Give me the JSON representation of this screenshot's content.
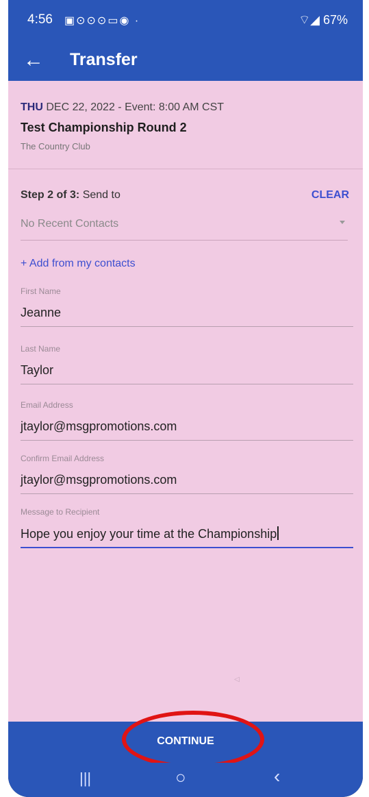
{
  "status_bar": {
    "time": "4:56",
    "notification_icons": "▣⊙⊙⊙▭◉ ·",
    "battery": "67%",
    "signal_glyph": "⌔◢"
  },
  "app_bar": {
    "title": "Transfer",
    "back_glyph": "←"
  },
  "event": {
    "day": "THU",
    "date_time": "DEC 22, 2022 - Event: 8:00 AM CST",
    "name": "Test Championship Round 2",
    "venue": "The Country Club"
  },
  "step": {
    "prefix": "Step 2 of 3:",
    "label": "Send to",
    "clear_label": "CLEAR"
  },
  "recent_contacts": {
    "value": "No Recent Contacts"
  },
  "add_contacts_label": "+ Add from my contacts",
  "fields": {
    "first_name": {
      "label": "First Name",
      "value": "Jeanne"
    },
    "last_name": {
      "label": "Last Name",
      "value": "Taylor"
    },
    "email": {
      "label": "Email Address",
      "value": "jtaylor@msgpromotions.com"
    },
    "confirm_email": {
      "label": "Confirm Email Address",
      "value": "jtaylor@msgpromotions.com"
    },
    "message": {
      "label": "Message to Recipient",
      "value": "Hope you enjoy your time at the Championship"
    }
  },
  "nav_hint_glyph": "◁",
  "continue_label": "CONTINUE",
  "system_nav": {
    "recents_glyph": "|||",
    "home_glyph": "○",
    "back_glyph": "‹"
  },
  "colors": {
    "accent_blue": "#2a56b8",
    "content_pink": "#f1cbe3",
    "link_blue": "#3d4fd0",
    "highlight_red": "#e01414"
  }
}
